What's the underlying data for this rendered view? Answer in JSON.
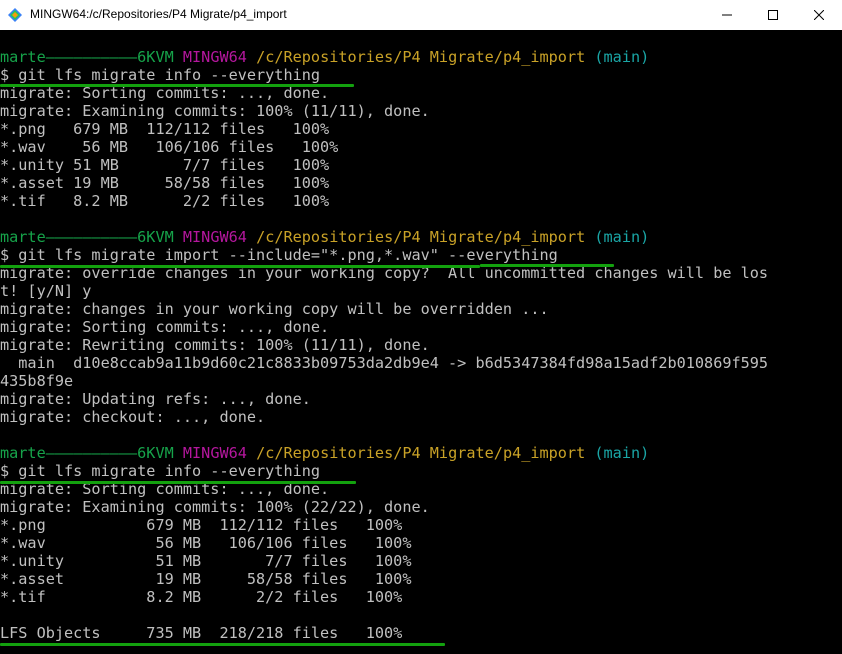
{
  "window": {
    "title": "MINGW64:/c/Repositories/P4 Migrate/p4_import",
    "icon": "mingw-icon",
    "controls": {
      "minimize": "minimize-icon",
      "maximize": "maximize-icon",
      "close": "close-icon"
    }
  },
  "colors": {
    "prompt_user": "#16a34a",
    "prompt_msys": "#b5179e",
    "prompt_path": "#c9a227",
    "prompt_branch": "#1aa6a6",
    "text": "#c0c0c0",
    "underline": "#13a10e"
  },
  "prompt": {
    "user_host": "marte——————————6KVM",
    "msystem": "MINGW64",
    "path": "/c/Repositories/P4 Migrate/p4_import",
    "branch": "(main)"
  },
  "session1": {
    "command": "$ git lfs migrate info --everything",
    "lines": [
      "migrate: Sorting commits: ..., done.",
      "migrate: Examining commits: 100% (11/11), done.",
      "*.png   679 MB  112/112 files   100%",
      "*.wav    56 MB   106/106 files   100%",
      "*.unity 51 MB       7/7 files   100%",
      "*.asset 19 MB     58/58 files   100%",
      "*.tif   8.2 MB      2/2 files   100%"
    ]
  },
  "session2": {
    "command": "$ git lfs migrate import --include=\"*.png,*.wav\" --everything",
    "lines": [
      "migrate: override changes in your working copy?  All uncommitted changes will be los",
      "t! [y/N] y",
      "migrate: changes in your working copy will be overridden ...",
      "migrate: Sorting commits: ..., done.",
      "migrate: Rewriting commits: 100% (11/11), done.",
      "  main  d10e8ccab9a11b9d60c21c8833b09753da2db9e4 -> b6d5347384fd98a15adf2b010869f595",
      "435b8f9e",
      "migrate: Updating refs: ..., done.",
      "migrate: checkout: ..., done."
    ]
  },
  "session3": {
    "command": "$ git lfs migrate info --everything",
    "lines": [
      "migrate: Sorting commits: ..., done.",
      "migrate: Examining commits: 100% (22/22), done.",
      "*.png           679 MB  112/112 files   100%",
      "*.wav            56 MB   106/106 files   100%",
      "*.unity          51 MB       7/7 files   100%",
      "*.asset          19 MB     58/58 files   100%",
      "*.tif           8.2 MB      2/2 files   100%"
    ],
    "summary": "LFS Objects     735 MB  218/218 files   100%"
  }
}
